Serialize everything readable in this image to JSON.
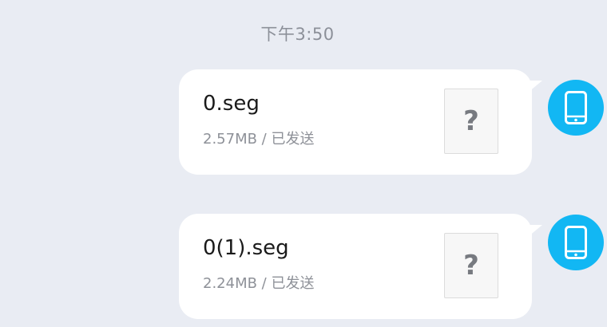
{
  "timestamp": "下午3:50",
  "messages": [
    {
      "file_name": "0.seg",
      "meta": "2.57MB / 已发送",
      "thumb_glyph": "?",
      "avatar_icon": "phone-icon"
    },
    {
      "file_name": "0(1).seg",
      "meta": "2.24MB / 已发送",
      "thumb_glyph": "?",
      "avatar_icon": "phone-icon"
    }
  ],
  "colors": {
    "background": "#e9ecf3",
    "bubble": "#ffffff",
    "avatar": "#12b7f3"
  }
}
